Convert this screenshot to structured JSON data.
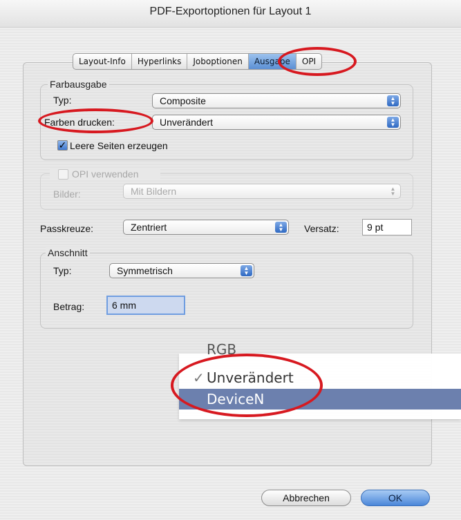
{
  "window": {
    "title": "PDF-Exportoptionen für Layout 1"
  },
  "tabs": [
    {
      "label": "Layout-Info",
      "active": false
    },
    {
      "label": "Hyperlinks",
      "active": false
    },
    {
      "label": "Joboptionen",
      "active": false
    },
    {
      "label": "Ausgabe",
      "active": true
    },
    {
      "label": "OPI",
      "active": false
    }
  ],
  "farbausgabe": {
    "title": "Farbausgabe",
    "typ_label": "Typ:",
    "typ_value": "Composite",
    "farben_label": "Farben drucken:",
    "farben_value": "Unverändert",
    "leere_seiten_label": "Leere Seiten erzeugen",
    "leere_seiten_checked": true
  },
  "opi": {
    "label": "OPI verwenden",
    "checked": false,
    "enabled": false,
    "bilder_label": "Bilder:",
    "bilder_value": "Mit Bildern"
  },
  "passkreuze": {
    "label": "Passkreuze:",
    "value": "Zentriert",
    "versatz_label": "Versatz:",
    "versatz_value": "9 pt"
  },
  "anschnitt": {
    "title": "Anschnitt",
    "typ_label": "Typ:",
    "typ_value": "Symmetrisch",
    "betrag_label": "Betrag:",
    "betrag_value": "6 mm"
  },
  "dropdown_menu": {
    "partial_item": "RGB",
    "items": [
      {
        "label": "Unverändert",
        "checked": true,
        "highlighted": false
      },
      {
        "label": "DeviceN",
        "checked": false,
        "highlighted": true
      }
    ]
  },
  "buttons": {
    "cancel": "Abbrechen",
    "ok": "OK"
  },
  "colors": {
    "highlight_ring": "#d71920",
    "menu_highlight": "#6c80ae",
    "accent": "#4a86d9"
  }
}
